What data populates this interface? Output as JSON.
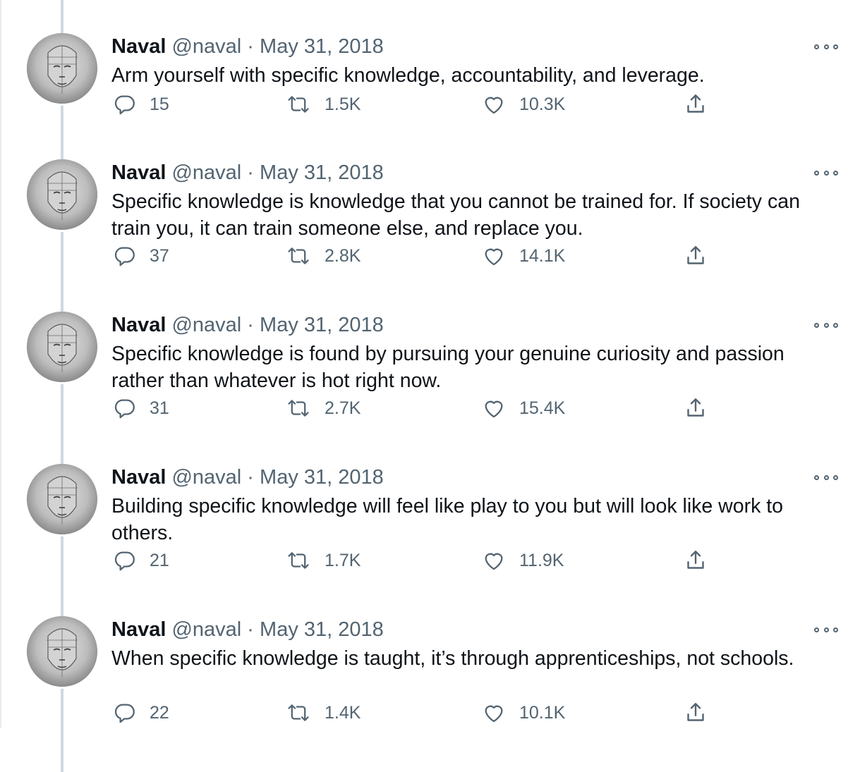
{
  "tweets": [
    {
      "name": "Naval",
      "handle": "@naval",
      "separator": "·",
      "date": "May 31, 2018",
      "text": "Arm yourself with specific knowledge, accountability, and leverage.",
      "replies": "15",
      "retweets": "1.5K",
      "likes": "10.3K"
    },
    {
      "name": "Naval",
      "handle": "@naval",
      "separator": "·",
      "date": "May 31, 2018",
      "text": "Specific knowledge is knowledge that you cannot be trained for. If society can train you, it can train someone else, and replace you.",
      "replies": "37",
      "retweets": "2.8K",
      "likes": "14.1K"
    },
    {
      "name": "Naval",
      "handle": "@naval",
      "separator": "·",
      "date": "May 31, 2018",
      "text": "Specific knowledge is found by pursuing your genuine curiosity and passion rather than whatever is hot right now.",
      "replies": "31",
      "retweets": "2.7K",
      "likes": "15.4K"
    },
    {
      "name": "Naval",
      "handle": "@naval",
      "separator": "·",
      "date": "May 31, 2018",
      "text": "Building specific knowledge will feel like play to you but will look like work to others.",
      "replies": "21",
      "retweets": "1.7K",
      "likes": "11.9K"
    },
    {
      "name": "Naval",
      "handle": "@naval",
      "separator": "·",
      "date": "May 31, 2018",
      "text": "When specific knowledge is taught, it’s through apprenticeships, not schools.",
      "replies": "22",
      "retweets": "1.4K",
      "likes": "10.1K"
    }
  ],
  "icons": {
    "reply": "reply-icon",
    "retweet": "retweet-icon",
    "like": "heart-icon",
    "share": "share-icon",
    "more": "more-options-icon"
  },
  "colors": {
    "text": "#0f1419",
    "secondary": "#536471",
    "connector": "#cfd9de"
  }
}
